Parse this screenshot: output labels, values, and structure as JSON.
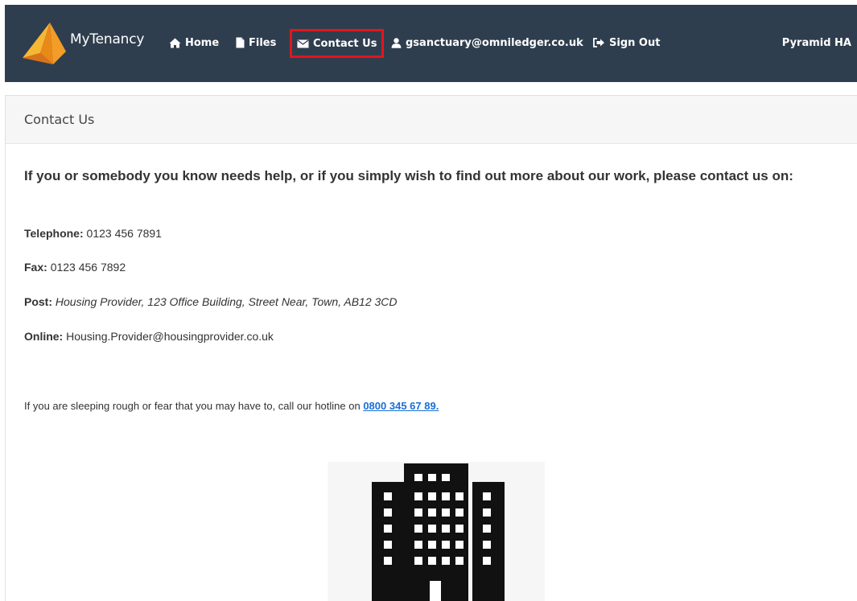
{
  "navbar": {
    "brand": "MyTenancy",
    "items": [
      {
        "label": "Home",
        "icon": "home-icon"
      },
      {
        "label": "Files",
        "icon": "file-icon"
      },
      {
        "label": "Contact Us",
        "icon": "envelope-icon"
      },
      {
        "label": "gsanctuary@omniledger.co.uk",
        "icon": "user-icon"
      },
      {
        "label": "Sign Out",
        "icon": "sign-out-icon"
      }
    ],
    "organisation": "Pyramid HA",
    "active_item": "Contact Us",
    "highlight_color": "#e0161c",
    "background_color": "#2f3e4e"
  },
  "panel": {
    "heading": "Contact Us",
    "lead": "If you or somebody you know needs help, or if you simply wish to find out more about our work, please contact us on:",
    "telephone": {
      "label": "Telephone:",
      "value": "0123 456 7891"
    },
    "fax": {
      "label": "Fax:",
      "value": "0123 456 7892"
    },
    "post": {
      "label": "Post:",
      "value": "Housing Provider, 123 Office Building, Street Near, Town, AB12 3CD"
    },
    "online": {
      "label": "Online:",
      "value": "Housing.Provider@housingprovider.co.uk"
    },
    "rough_sleeping": {
      "text": "If you are sleeping rough or fear that you may have to, call our hotline on",
      "hotline": "0800 345 67 89."
    },
    "image": "building-icon"
  }
}
